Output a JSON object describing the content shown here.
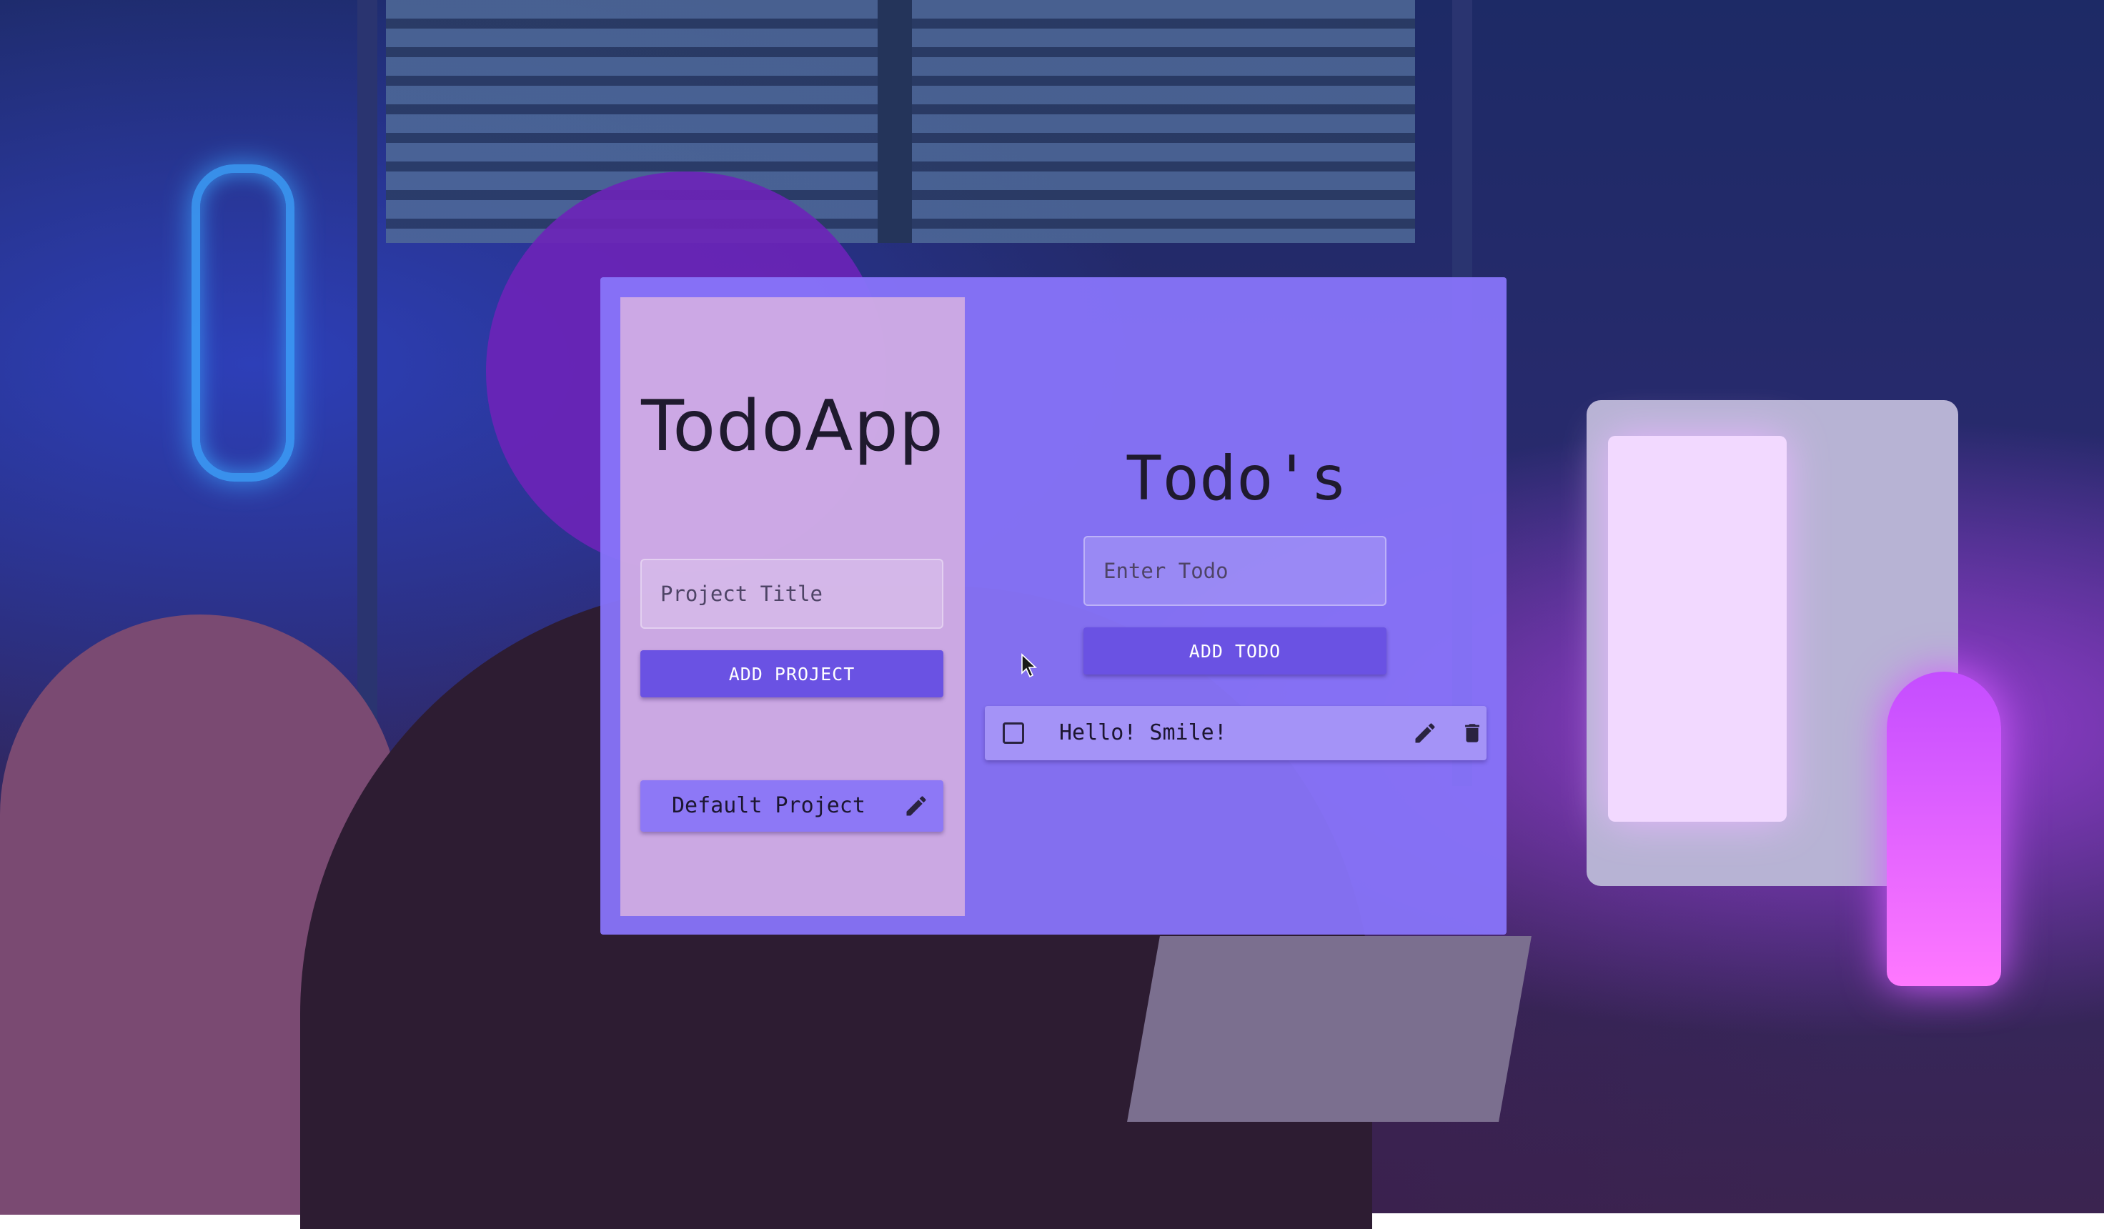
{
  "sidebar": {
    "app_title": "TodoApp",
    "project_input": {
      "value": "",
      "placeholder": "Project Title"
    },
    "add_project_label": "ADD PROJECT",
    "projects": [
      {
        "label": "Default Project",
        "icon": "pencil-icon"
      }
    ]
  },
  "main": {
    "title": "Todo's",
    "todo_input": {
      "value": "",
      "placeholder": "Enter Todo"
    },
    "add_todo_label": "ADD TODO",
    "todos": [
      {
        "text": "Hello! Smile!",
        "checked": false,
        "icons": [
          "pencil-icon",
          "trash-icon"
        ]
      }
    ]
  },
  "colors": {
    "card": "#8874FA",
    "sidebar": "#E8BEDE",
    "button": "#6A52E3",
    "text_dark": "#1F1A2E"
  }
}
